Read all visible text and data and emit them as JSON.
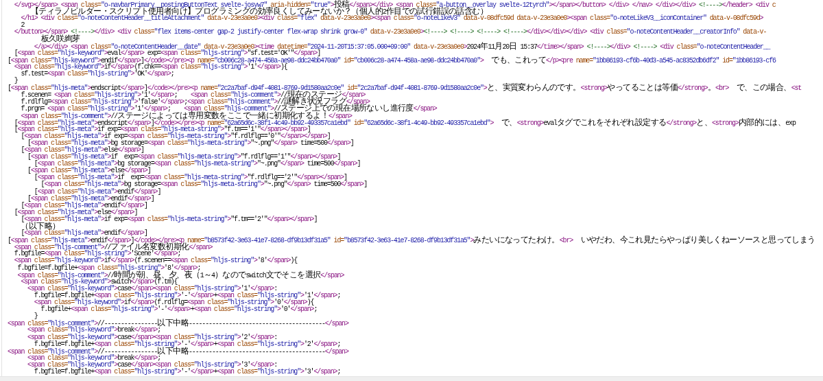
{
  "source_lines": [
    "  </svg></span> <span class=\"o-navbarPrimary__postingButtonText svelte-josyw7\" aria-hidden=\"true\">投稿</span></div> <span class=\"a-button__overlay svelte-12tyrch\"></span></button> </div> </nav> </div></div> <!----></header> <div c",
    "       【ティラノビルダー・スクリプト使用者向け】プログラミングの効率良くしてみーないか？（個人的2作目での試行錯誤の話含む）",
    "    </h1> <div class=\"o-noteContentHeader__titleAttachment\" data-v-23e3a0e0><div class=\"flex\" data-v-23e3a0e0><span class=\"o-noteLikeV3\" data-v-08dfc59d data-v-23e3a0e0><span class=\"o-noteLikeV3__iconContainer\" data-v-08dfc59d>",
    "    2",
    "  </button></span> <!----></div> <div class=\"flex items-center gap-2 justify-center flex-wrap shrink grow-0\" data-v-23e3a0e0><!----> <!----> <!----> <!----></div></div></div> <div class=\"o-noteContentHeader__creatorInfo\" data-v-",
    "          板久咲絢芽",
    "        </a></div> <span class=\"o-noteContentHeader__date\" data-v-23e3a0e0><time datetime=\"2024-11-20T15:37:05.000+09:00\" data-v-23e3a0e0>2024年11月20日 15:37</time></span> <!----></div> <!----> <div class=\"o-noteContentHeader__",
    "  [<span class=\"hljs-keyword\">eval</span> exp=<span class=\"hljs-string\">\"sf.test='OK'\"</span>]",
    "[<span class=\"hljs-keyword\">endif</span>]</code></pre><p name=\"cb006c28-a474-458a-ae98-ddc24bb470a0\" id=\"cb006c28-a474-458a-ae98-ddc24bb470a0\">　でも、これって</p><pre name=\"1bb86193-cf6b-40d3-a545-ac8352db6df2\" id=\"1bb86193-cf6",
    "  <span class=\"hljs-keyword\">if</span>(f.chk==<span class=\"hljs-string\">'1'</span>){",
    "    sf.test=<span class=\"hljs-string\">'OK'</span>;",
    "  }",
    "[<span class=\"hljs-meta\">endscript</span>]</code></pre><p name=\"2c2a7baf-d94f-4081-8769-9d1580aa2c0e\" id=\"2c2a7baf-d94f-4081-8769-9d1580aa2c0e\">と、実質変わらんのです。<strong>やってることは等価</strong>。<br>　で、この場合、<st",
    "    f.scenen= <span class=\"hljs-string\">'1'</span>;    <span class=\"hljs-comment\">//現在のステージ</span>",
    "    f.rdlflg=<span class=\"hljs-string\">'false'</span>;<span class=\"hljs-comment\">//謎解き状況フラグ</span>",
    "    f.prgn= <span class=\"hljs-string\">'1'</span>;    <span class=\"hljs-comment\">//ステージ上での現在場所ないし進行度</span>",
    "    <span class=\"hljs-comment\">//ステージによっては専用変数をここで一緒に初期化するよ！</span>",
    "  [<span class=\"hljs-meta\">endscript</span>]</code></pre><p name=\"62a65d6c-38f1-4c49-bb92-493357ca1ebd\" id=\"62a65d6c-38f1-4c49-bb92-493357ca1ebd\">　で、<strong>evalタグでこれをそれぞれ設定する</strong>と、<strong>内部的には、exp",
    "  [<span class=\"hljs-meta\">if exp=<span class=\"hljs-meta-string\">\"f.tm=='1'\"</span></span>]",
    "    [<span class=\"hljs-meta\">if exp=<span class=\"hljs-meta-string\">\"f.rdlflg=='0'\"</span></span>]",
    "      [<span class=\"hljs-meta\">bg storage=<span class=\"hljs-meta-string\">\"~.png\"</span> time=500</span>]",
    "    [<span class=\"hljs-meta\">else</span>]",
    "      [<span class=\"hljs-meta\">if  exp=<span class=\"hljs-meta-string\">\"f.rdlflg=='1'\"</span></span>]",
    "        [<span class=\"hljs-meta\">bg storage=<span class=\"hljs-meta-string\">\"~.png\"</span> time=500</span>]",
    "      [<span class=\"hljs-meta\">else</span>]",
    "        [<span class=\"hljs-meta\">if  exp=<span class=\"hljs-meta-string\">\"f.rdlflg=='2'\"</span></span>]",
    "          [<span class=\"hljs-meta\">bg storage=<span class=\"hljs-meta-string\">\"~.png\"</span> time=500</span>]",
    "        [<span class=\"hljs-meta\">endif</span>]",
    "      [<span class=\"hljs-meta\">endif</span>]",
    "    [<span class=\"hljs-meta\">endif</span>]",
    "  [<span class=\"hljs-meta\">else</span>]",
    "    [<span class=\"hljs-meta\">if exp=<span class=\"hljs-meta-string\">\"f.tm=='2'\"</span></span>]",
    "    （以下略）",
    "    [<span class=\"hljs-meta\">endif</span>]",
    "[<span class=\"hljs-meta\">endif</span>]</code></pre><p name=\"b8573f42-3e63-41e7-8268-df9b13df31a5\" id=\"b8573f42-3e63-41e7-8268-df9b13df31a5\">みたいになってたわけ。<br>　いやだわ、今これ見たらやっぱり美しくねーソースと思ってしまう",
    "  <span class=\"hljs-comment\">//ファイル名変数初期化</span>",
    "  f.bgfile=<span class=\"hljs-string\">'Scene'</span>;",
    "  <span class=\"hljs-keyword\">if</span>(f.scenen==<span class=\"hljs-string\">'8'</span>){",
    "   f.bgfile=f.bgfile+<span class=\"hljs-string\">'8'</span>;",
    "   <span class=\"hljs-comment\">//時間が朝、昼、夕、夜（1～4）なのでswitch文でそこを選択</span>",
    "    <span class=\"hljs-keyword\">switch</span>(f.tm){",
    "      <span class=\"hljs-keyword\">case</span><span class=\"hljs-string\">'1'</span>:",
    "        f.bgfile=f.bgfile+<span class=\"hljs-string\">'-'</span>+<span class=\"hljs-string\">'1'</span>;",
    "        <span class=\"hljs-keyword\">if</span>(f.rdlflg=<span class=\"hljs-string\">'0'</span>){",
    "          f.bgfile+<span class=\"hljs-string\">'-'</span>+<span class=\"hljs-string\">'0'</span>;",
    "        }",
    "<span class=\"hljs-comment\">//----------------以下中略-----------------------------------------</span>",
    "      <span class=\"hljs-keyword\">break</span>;",
    "      <span class=\"hljs-keyword\">case</span><span class=\"hljs-string\">'2'</span>:",
    "        f.bgfile=f.bgfile+<span class=\"hljs-string\">'-'</span>+<span class=\"hljs-string\">'2'</span>;",
    "<span class=\"hljs-comment\">//----------------以下中略-----------------------------------------</span>",
    "      <span class=\"hljs-keyword\">break</span>;",
    "      <span class=\"hljs-keyword\">case</span><span class=\"hljs-string\">'3'</span>:",
    "        f.bgfile=f.bgfile+<span class=\"hljs-string\">'-'</span>+<span class=\"hljs-string\">'3'</span>;"
  ]
}
